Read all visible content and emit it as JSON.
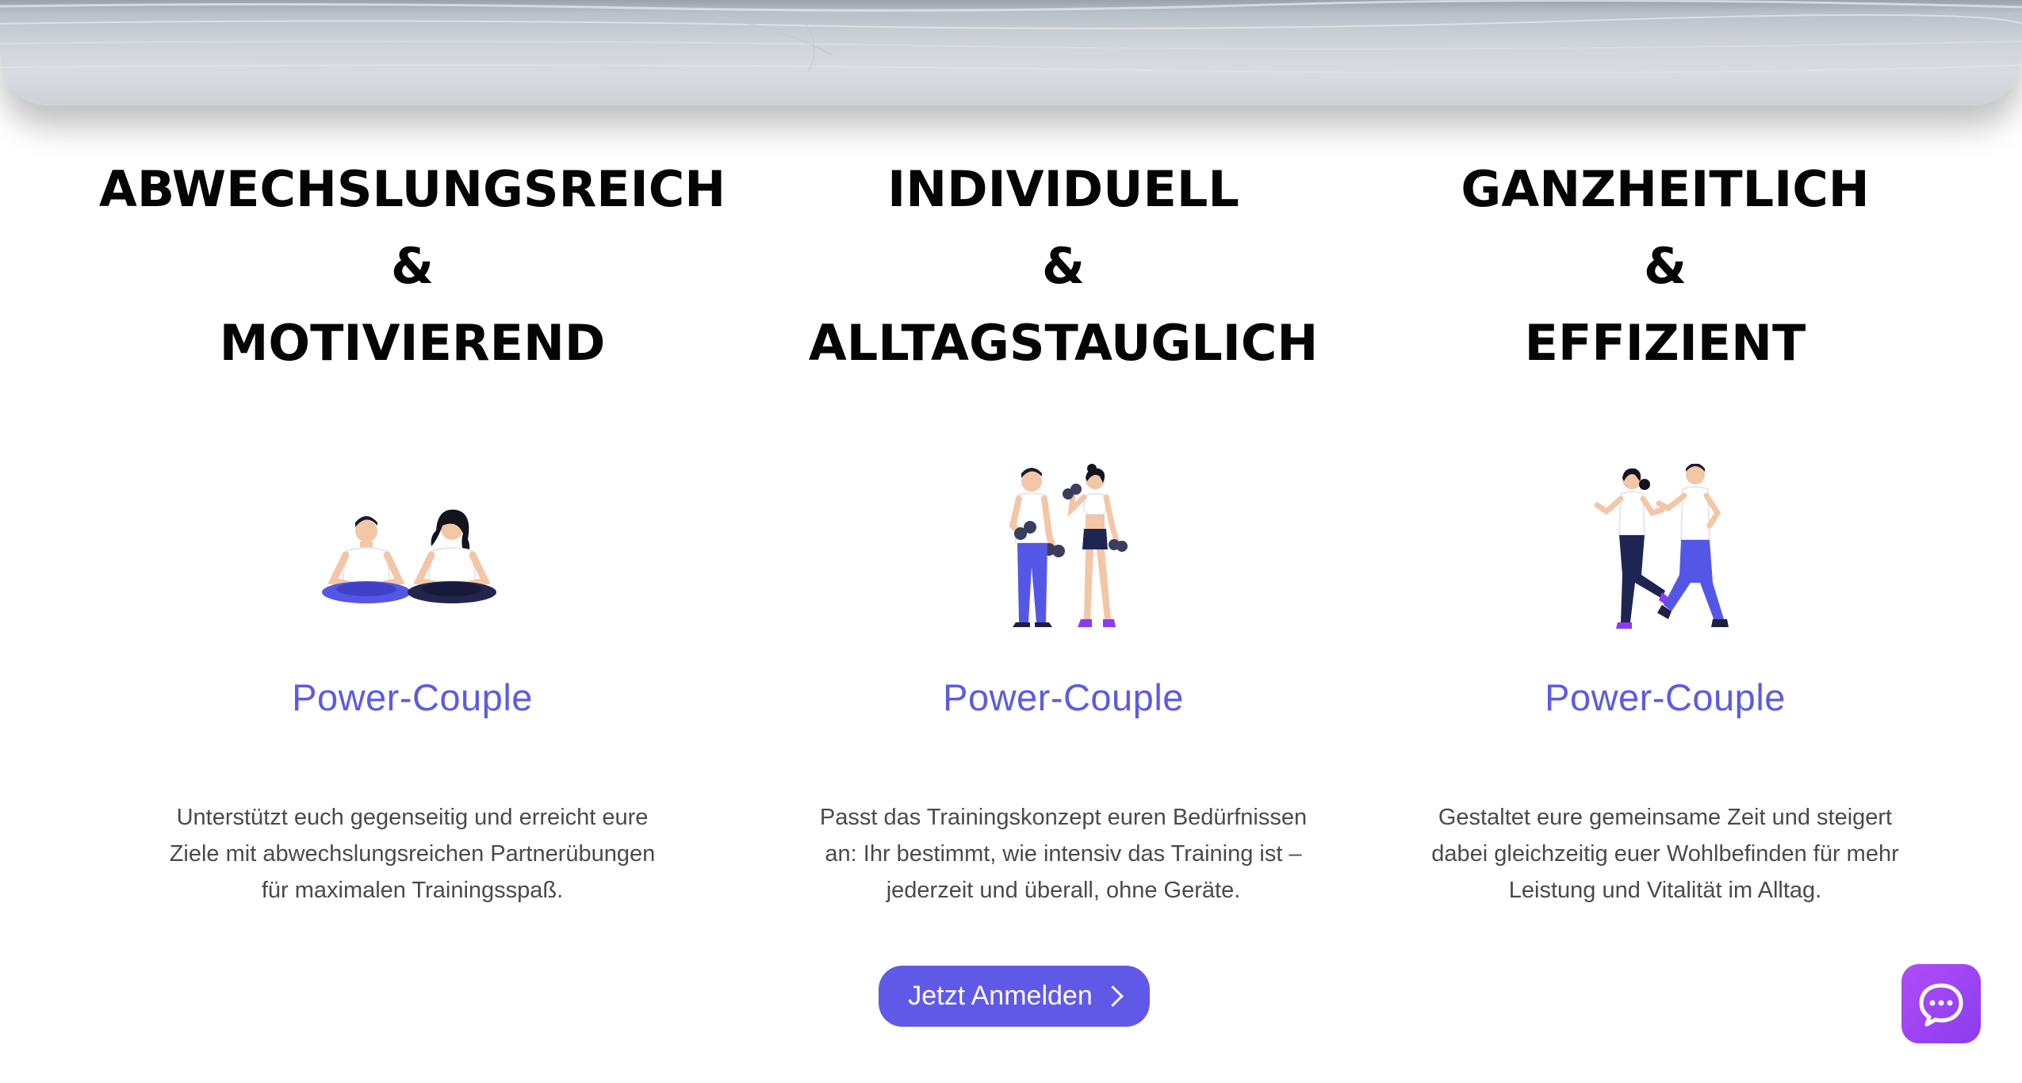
{
  "colors": {
    "accent": "#5b5ce0",
    "button": "#6059e8",
    "chat_button": "#9b45f3",
    "heading": "#050505",
    "body_text": "#4a4a4a"
  },
  "columns": [
    {
      "heading": [
        "ABWECHSLUNGSREICH",
        "&",
        "MOTIVIEREND"
      ],
      "illustration": "couple-meditating-illustration",
      "subtitle": "Power-Couple",
      "description": [
        "Unterstützt euch gegenseitig und erreicht eure",
        "Ziele mit abwechslungsreichen Partnerübungen",
        "für maximalen Trainingsspaß."
      ]
    },
    {
      "heading": [
        "INDIVIDUELL",
        "&",
        "ALLTAGSTAUGLICH"
      ],
      "illustration": "couple-dumbbells-illustration",
      "subtitle": "Power-Couple",
      "description": [
        "Passt das Trainingskonzept euren Bedürfnissen",
        "an: Ihr bestimmt, wie intensiv das Training ist –",
        "jederzeit und überall, ohne Geräte."
      ]
    },
    {
      "heading": [
        "GANZHEITLICH",
        "&",
        "EFFIZIENT"
      ],
      "illustration": "couple-running-illustration",
      "subtitle": "Power-Couple",
      "description": [
        "Gestaltet eure gemeinsame Zeit und steigert",
        "dabei gleichzeitig euer Wohlbefinden für mehr",
        "Leistung und Vitalität im Alltag."
      ]
    }
  ],
  "cta": {
    "label": "Jetzt Anmelden",
    "icon": "chevron-right-icon"
  },
  "chat": {
    "icon": "chat-bubble-icon"
  }
}
